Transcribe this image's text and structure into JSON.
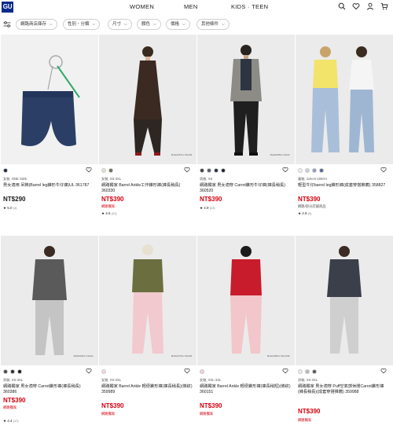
{
  "header": {
    "logo": "GU",
    "nav": [
      "WOMEN",
      "MEN",
      "KIDS · TEEN"
    ]
  },
  "filters": {
    "chips": [
      "網路商店庫存",
      "性別・分類",
      "尺寸",
      "顏色",
      "價格",
      "其他條件"
    ]
  },
  "products": [
    {
      "meta": "女裝, ONE SIZE",
      "title": "男女適用 吊飾(Barrel leg錐形牛仔褲)UL 361787",
      "price": "NT$290",
      "price_color": "black",
      "tag": "",
      "rating": "★ 5.0",
      "rating_count": "(4)",
      "swatches": [
        "#1c2840"
      ],
      "model_note": ""
    },
    {
      "meta": "女裝, XS-3XL",
      "title": "網路獨家 Barrel Ankle工作錐形褲(褲長稍長) 360330",
      "price": "NT$390",
      "price_color": "red",
      "tag": "網路獨家",
      "rating": "★ 4.5",
      "rating_count": "(21)",
      "swatches": [
        "#e8e0cf",
        "#6a6f5a"
      ],
      "model_note": "Model/167cm Size/M"
    },
    {
      "meta": "男裝, XS",
      "title": "網路獨家 男女適穿 Carrot錐形牛仔褲(褲長稍長) 360520",
      "price": "NT$390",
      "price_color": "red",
      "tag": "",
      "rating": "★ 4.9",
      "rating_count": "(22)",
      "swatches": [
        "#3a3f4a",
        "#555b66",
        "#23303f",
        "#1d2430"
      ],
      "model_note": "Model/185cm Size/L"
    },
    {
      "meta": "童裝, 110cm-160cm",
      "title": "輕型牛仔barrel leg錐形褲(成套穿搭推薦) 358827",
      "price": "NT$390",
      "price_color": "red",
      "tag": "網路/部分店鋪商品",
      "rating": "★ 4.9",
      "rating_count": "(9)",
      "swatches": [
        "#eeeeee",
        "#c9cfd8",
        "#8aa0bd",
        "#4f6a8e"
      ],
      "model_note": ""
    },
    {
      "meta": "男裝, XS-3XL",
      "title": "網路獨家 男女適穿 Carrot錐形褲(褲長稍長) 360386",
      "price": "NT$390",
      "price_color": "red",
      "tag": "網路獨家",
      "rating": "★ 4.4",
      "rating_count": "(17)",
      "swatches": [
        "#4a4a4a",
        "#2b2b2b",
        "#1a1a1a"
      ],
      "model_note": "Model/181cm Size/L"
    },
    {
      "meta": "女裝, XS-3XL",
      "title": "網路獨家 Barrel Ankle 輕便錐形褲(褲長稍長)(條紋) 359989",
      "price": "NT$390",
      "price_color": "red",
      "tag": "網路獨家",
      "rating": "",
      "rating_count": "",
      "swatches": [
        "#f6d6dc"
      ],
      "model_note": "Model/172cm Size/M"
    },
    {
      "meta": "女裝, XXL-3XL",
      "title": "網路獨家 Barrel Ankle 輕便錐形褲(褲長稍短)(條紋) 360151",
      "price": "NT$390",
      "price_color": "red",
      "tag": "網路獨家",
      "rating": "",
      "rating_count": "",
      "swatches": [
        "#f3d0d4"
      ],
      "model_note": "Model/166cm Size/XXL"
    },
    {
      "meta": "男裝, XS-3XL",
      "title": "網路獨家 男女適穿 Puff空氣感休閒Carrot錐形褲(褲長稍長)(成套穿搭推薦) 359988",
      "price": "NT$390",
      "price_color": "red",
      "tag": "網路獨家",
      "rating": "",
      "rating_count": "",
      "swatches": [
        "#ececec",
        "#b7b7b7",
        "#5a5a5a"
      ],
      "model_note": ""
    }
  ]
}
